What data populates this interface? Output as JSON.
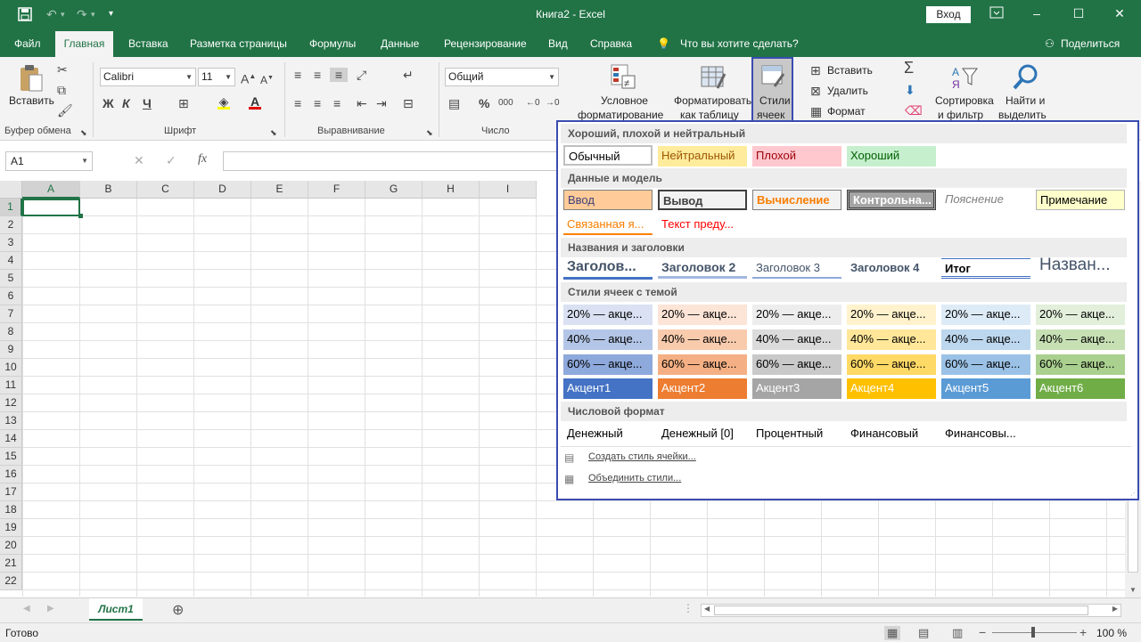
{
  "titlebar": {
    "title": "Книга2  -  Excel",
    "login": "Вход",
    "qat_dropdown": "▾"
  },
  "tabs": [
    {
      "label": "Файл"
    },
    {
      "label": "Главная"
    },
    {
      "label": "Вставка"
    },
    {
      "label": "Разметка страницы"
    },
    {
      "label": "Формулы"
    },
    {
      "label": "Данные"
    },
    {
      "label": "Рецензирование"
    },
    {
      "label": "Вид"
    },
    {
      "label": "Справка"
    },
    {
      "label": "Что вы хотите сделать?"
    }
  ],
  "share": "Поделиться",
  "ribbon": {
    "paste": "Вставить",
    "font_name": "Calibri",
    "font_size": "11",
    "number_format": "Общий",
    "bold": "Ж",
    "italic": "К",
    "underline": "Ч",
    "percent": "%",
    "conditional_1": "Условное",
    "conditional_2": "форматирование",
    "table_1": "Форматировать",
    "table_2": "как таблицу",
    "styles_1": "Стили",
    "styles_2": "ячеек",
    "insert": "Вставить",
    "delete": "Удалить",
    "format": "Формат",
    "sort_1": "Сортировка",
    "sort_2": "и фильтр",
    "find_1": "Найти и",
    "find_2": "выделить",
    "groups": {
      "clipboard": "Буфер обмена",
      "font": "Шрифт",
      "align": "Выравнивание",
      "number": "Число"
    }
  },
  "formula": {
    "namebox": "A1",
    "fx": "fx",
    "cancel": "✕",
    "enter": "✓"
  },
  "columns": [
    "A",
    "B",
    "C",
    "D",
    "E",
    "F",
    "G",
    "H",
    "I"
  ],
  "rows": [
    "1",
    "2",
    "3",
    "4",
    "5",
    "6",
    "7",
    "8",
    "9",
    "10",
    "11",
    "12",
    "13",
    "14",
    "15",
    "16",
    "17",
    "18",
    "19",
    "20",
    "21",
    "22"
  ],
  "sheet": {
    "tab": "Лист1",
    "add": "⊕"
  },
  "status": {
    "ready": "Готово",
    "zoom": "100 %"
  },
  "gallery": {
    "sections": {
      "good_bad": "Хороший, плохой и нейтральный",
      "data_model": "Данные и модель",
      "titles": "Названия и заголовки",
      "themed": "Стили ячеек с темой",
      "number": "Числовой формат"
    },
    "good_bad": [
      "Обычный",
      "Нейтральный",
      "Плохой",
      "Хороший"
    ],
    "data_model": [
      "Ввод",
      "Вывод",
      "Вычисление",
      "Контрольна...",
      "Пояснение",
      "Примечание",
      "Связанная я...",
      "Текст преду..."
    ],
    "titles": [
      "Заголов...",
      "Заголовок 2",
      "Заголовок 3",
      "Заголовок 4",
      "Итог",
      "Назван..."
    ],
    "themed20": [
      "20% — акце...",
      "20% — акце...",
      "20% — акце...",
      "20% — акце...",
      "20% — акце...",
      "20% — акце..."
    ],
    "themed40": [
      "40% — акце...",
      "40% — акце...",
      "40% — акце...",
      "40% — акце...",
      "40% — акце...",
      "40% — акце..."
    ],
    "themed60": [
      "60% — акце...",
      "60% — акце...",
      "60% — акце...",
      "60% — акце...",
      "60% — акце...",
      "60% — акце..."
    ],
    "accents": [
      "Акцент1",
      "Акцент2",
      "Акцент3",
      "Акцент4",
      "Акцент5",
      "Акцент6"
    ],
    "number": [
      "Денежный",
      "Денежный [0]",
      "Процентный",
      "Финансовый",
      "Финансовы..."
    ],
    "create": "Создать стиль ячейки...",
    "merge": "Объединить стили..."
  },
  "colors": {
    "accent": "#217346",
    "gallery_border": "#3a4cb0"
  }
}
